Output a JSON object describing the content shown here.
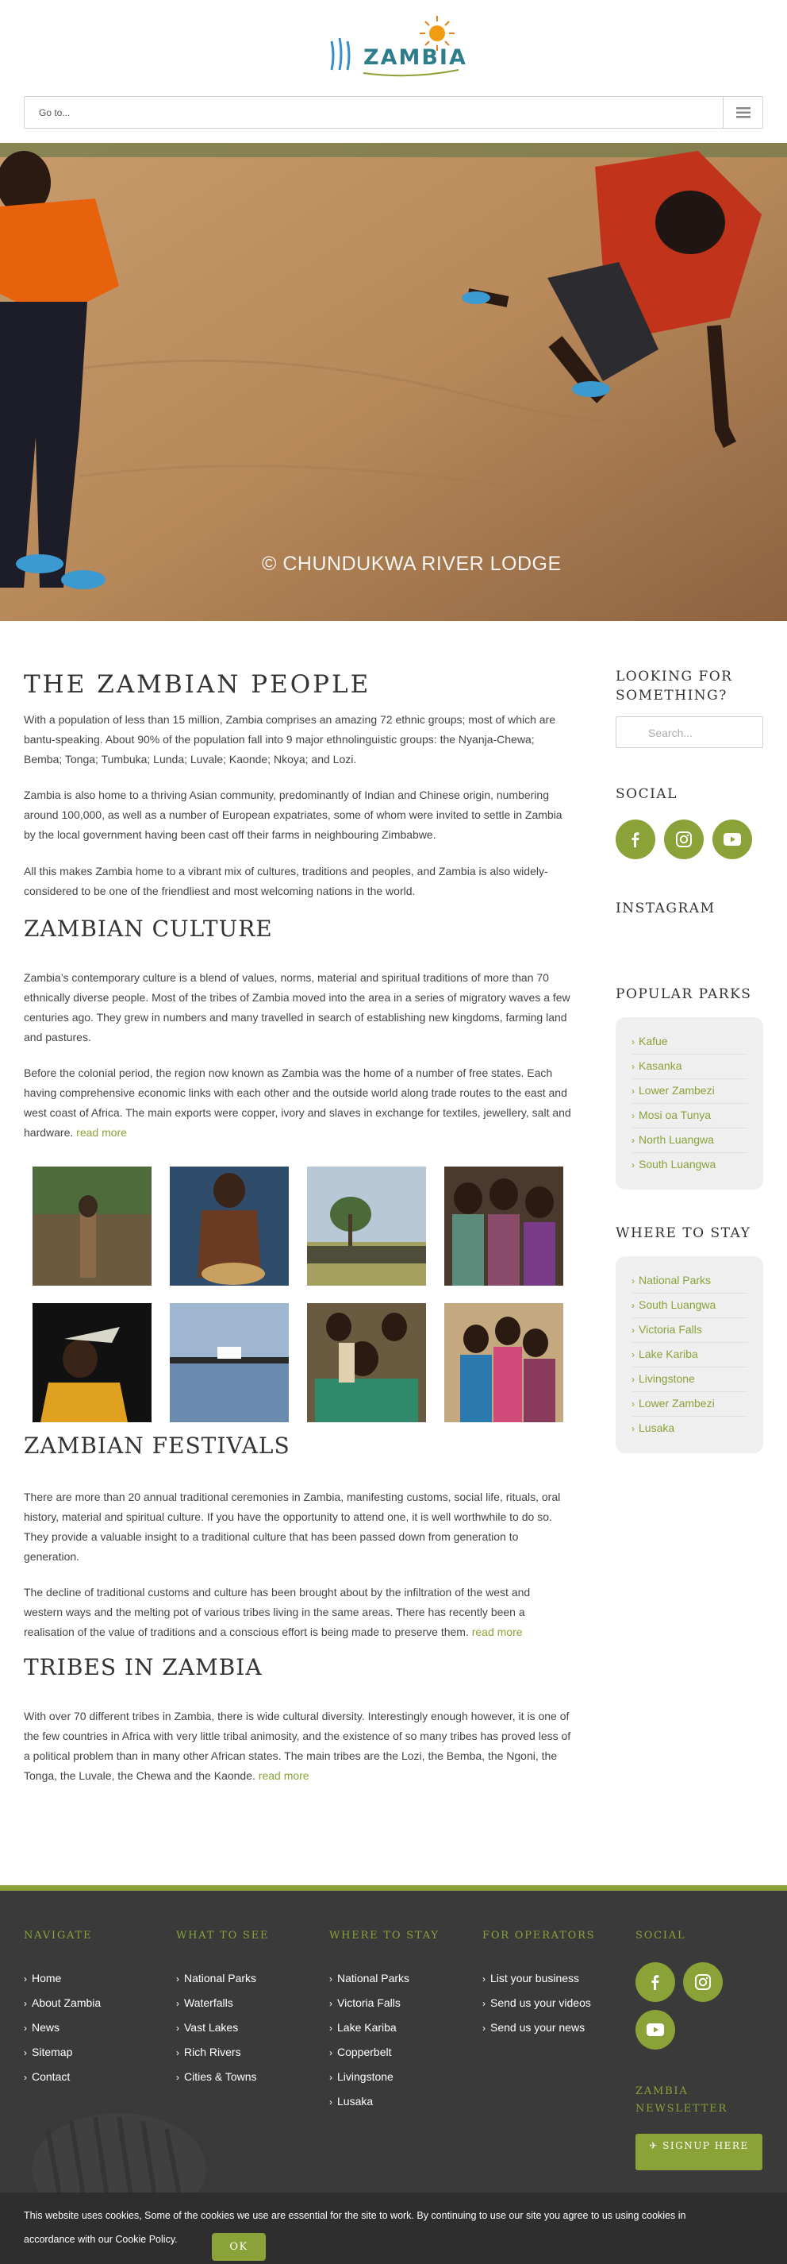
{
  "header": {
    "logo_text": "ZAMBIA",
    "nav_placeholder": "Go to..."
  },
  "hero": {
    "credit": "© CHUNDUKWA RIVER LODGE"
  },
  "main": {
    "people": {
      "title": "THE ZAMBIAN PEOPLE",
      "p1": "With a population of less than 15 million, Zambia comprises an amazing 72 ethnic groups; most of which are bantu-speaking. About 90% of the population fall into 9 major ethnolinguistic groups: the Nyanja-Chewa; Bemba; Tonga; Tumbuka; Lunda; Luvale; Kaonde; Nkoya; and Lozi.",
      "p2": "Zambia is also home to a thriving Asian community, predominantly of Indian and Chinese origin, numbering around 100,000, as well as a number of European expatriates, some of whom were invited to settle in Zambia by the local government having been cast off their farms in neighbouring Zimbabwe.",
      "p3": "All this makes Zambia home to a vibrant mix of cultures, traditions and peoples, and Zambia is also widely-considered to be one of the friendliest and most welcoming nations in the world."
    },
    "culture": {
      "title": "ZAMBIAN CULTURE",
      "p1": "Zambia’s contemporary culture is a blend of values, norms, material and spiritual traditions of more than 70 ethnically diverse people. Most of the tribes of Zambia moved into the area in a series of migratory waves a few centuries ago. They grew in numbers and many travelled in search of establishing new kingdoms, farming land and pastures.",
      "p2": "Before the colonial period, the region now known as Zambia was the home of a number of free states. Each having comprehensive economic links with each other and the outside world along trade routes to the east and west coast of Africa. The main exports were copper, ivory and slaves in exchange for textiles, jewellery, salt and hardware.",
      "read_more": "read more"
    },
    "festivals": {
      "title": "ZAMBIAN FESTIVALS",
      "p1": "There are more than 20 annual traditional ceremonies in Zambia, manifesting customs, social life, rituals, oral history, material and spiritual culture. If you have the opportunity to attend one, it is well worthwhile to do so. They provide a valuable insight to a traditional culture that has been passed down from generation to generation.",
      "p2": "The decline of traditional customs and culture has been brought about by the infiltration of the west and western ways and the melting pot of various tribes living in the same areas. There has recently been a realisation of the value of traditions and a conscious effort is being made to preserve them.",
      "read_more": "read more"
    },
    "tribes": {
      "title": "TRIBES IN ZAMBIA",
      "p1": "With over 70 different tribes in Zambia, there is wide cultural diversity. Interestingly enough however, it is one of the few countries in Africa with very little tribal animosity, and the existence of so many tribes has proved less of a political problem than in many other African states. The main tribes are the Lozi, the Bemba, the Ngoni, the Tonga, the Luvale, the Chewa and the Kaonde.",
      "read_more": "read more"
    }
  },
  "sidebar": {
    "search_title": "LOOKING FOR SOMETHING?",
    "search_placeholder": "Search...",
    "social_title": "SOCIAL",
    "instagram_title": "INSTAGRAM",
    "parks_title": "POPULAR PARKS",
    "parks": [
      "Kafue",
      "Kasanka",
      "Lower Zambezi",
      "Mosi oa Tunya",
      "North Luangwa",
      "South Luangwa"
    ],
    "stay_title": "WHERE TO STAY",
    "stay": [
      "National Parks",
      "South Luangwa",
      "Victoria Falls",
      "Lake Kariba",
      "Livingstone",
      "Lower Zambezi",
      "Lusaka"
    ]
  },
  "footer": {
    "navigate_title": "NAVIGATE",
    "navigate": [
      "Home",
      "About Zambia",
      "News",
      "Sitemap",
      "Contact"
    ],
    "see_title": "WHAT TO SEE",
    "see": [
      "National Parks",
      "Waterfalls",
      "Vast Lakes",
      "Rich Rivers",
      "Cities & Towns"
    ],
    "stay_title": "WHERE TO STAY",
    "stay": [
      "National Parks",
      "Victoria Falls",
      "Lake Kariba",
      "Copperbelt",
      "Livingstone",
      "Lusaka"
    ],
    "operators_title": "FOR OPERATORS",
    "operators": [
      "List your business",
      "Send us your videos",
      "Send us your news"
    ],
    "social_title": "SOCIAL",
    "newsletter_title": "ZAMBIA NEWSLETTER",
    "signup_label": "SIGNUP HERE"
  },
  "cookie": {
    "text": "This website uses cookies, Some of the cookies we use are essential for the site to work. By continuing to use our site you agree to us using cookies in accordance with our Cookie Policy.",
    "ok_label": "OK"
  },
  "colors": {
    "accent": "#8aa238",
    "footer_bg": "#3a3a3a"
  }
}
